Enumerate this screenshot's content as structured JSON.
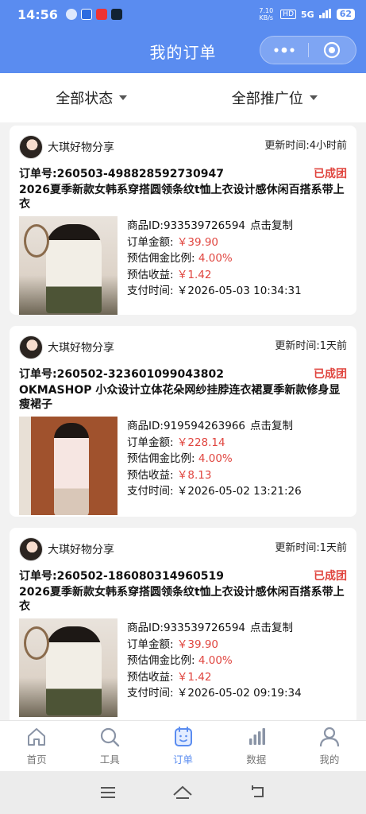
{
  "status_bar": {
    "time": "14:56",
    "net_speed": "7.10 KB/s",
    "network": "5G",
    "battery": "62"
  },
  "header": {
    "title": "我的订单"
  },
  "filters": [
    {
      "label": "全部状态"
    },
    {
      "label": "全部推广位"
    }
  ],
  "orders": [
    {
      "shop_name": "大琪好物分享",
      "update_time": "更新时间:4小时前",
      "order_no": "订单号:260503-498828592730947",
      "status": "已成团",
      "product_title": "2026夏季新款女韩系穿搭圆领条纹t恤上衣设计感休闲百搭系带上衣",
      "product_id_label": "商品ID:",
      "product_id": "933539726594",
      "copy_label": "点击复制",
      "amount_label": "订单金额:",
      "amount": "￥39.90",
      "commission_rate_label": "预估佣金比例:",
      "commission_rate": "4.00%",
      "income_label": "预估收益:",
      "income": "￥1.42",
      "pay_time_label": "支付时间:",
      "pay_time": "￥2026-05-03 10:34:31"
    },
    {
      "shop_name": "大琪好物分享",
      "update_time": "更新时间:1天前",
      "order_no": "订单号:260502-323601099043802",
      "status": "已成团",
      "product_title": "OKMASHOP 小众设计立体花朵网纱挂脖连衣裙夏季新款修身显瘦裙子",
      "product_id_label": "商品ID:",
      "product_id": "919594263966",
      "copy_label": "点击复制",
      "amount_label": "订单金额:",
      "amount": "￥228.14",
      "commission_rate_label": "预估佣金比例:",
      "commission_rate": "4.00%",
      "income_label": "预估收益:",
      "income": "￥8.13",
      "pay_time_label": "支付时间:",
      "pay_time": "￥2026-05-02 13:21:26"
    },
    {
      "shop_name": "大琪好物分享",
      "update_time": "更新时间:1天前",
      "order_no": "订单号:260502-186080314960519",
      "status": "已成团",
      "product_title": "2026夏季新款女韩系穿搭圆领条纹t恤上衣设计感休闲百搭系带上衣",
      "product_id_label": "商品ID:",
      "product_id": "933539726594",
      "copy_label": "点击复制",
      "amount_label": "订单金额:",
      "amount": "￥39.90",
      "commission_rate_label": "预估佣金比例:",
      "commission_rate": "4.00%",
      "income_label": "预估收益:",
      "income": "￥1.42",
      "pay_time_label": "支付时间:",
      "pay_time": "￥2026-05-02 09:19:34"
    }
  ],
  "tabs": [
    {
      "label": "首页",
      "icon": "home-icon"
    },
    {
      "label": "工具",
      "icon": "search-icon"
    },
    {
      "label": "订单",
      "icon": "order-icon",
      "active": true
    },
    {
      "label": "数据",
      "icon": "bar-chart-icon"
    },
    {
      "label": "我的",
      "icon": "user-icon"
    }
  ],
  "colors": {
    "brand": "#5a8cf0",
    "status_red": "#e0453f"
  }
}
